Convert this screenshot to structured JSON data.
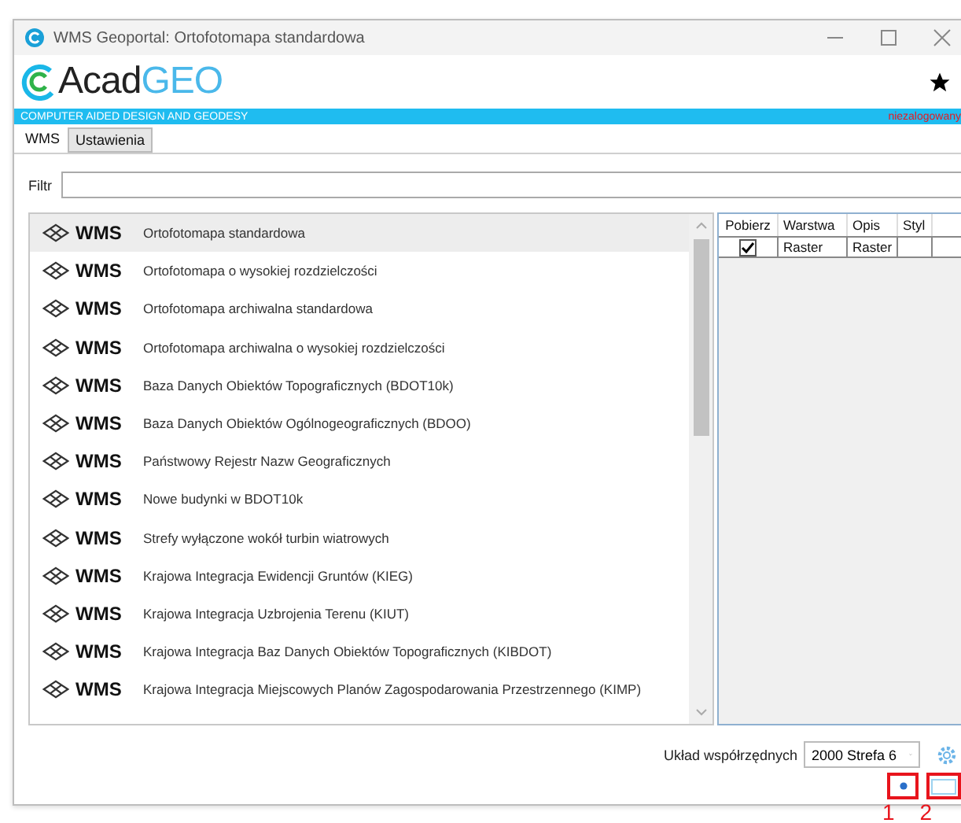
{
  "window": {
    "title": "WMS Geoportal: Ortofotomapa standardowa"
  },
  "logo": {
    "part_1": "Acad",
    "part_2": "GEO"
  },
  "banner": {
    "tagline": "COMPUTER AIDED DESIGN AND GEODESY",
    "status": "niezalogowany"
  },
  "tabs": [
    {
      "label": "WMS",
      "selected": true
    },
    {
      "label": "Ustawienia",
      "selected": false
    }
  ],
  "filter": {
    "label": "Filtr"
  },
  "services": [
    {
      "badge": "WMS",
      "name": "Ortofotomapa standardowa",
      "selected": true
    },
    {
      "badge": "WMS",
      "name": "Ortofotomapa o wysokiej rozdzielczości",
      "selected": false
    },
    {
      "badge": "WMS",
      "name": "Ortofotomapa archiwalna standardowa",
      "selected": false
    },
    {
      "badge": "WMS",
      "name": "Ortofotomapa archiwalna o wysokiej rozdzielczości",
      "selected": false
    },
    {
      "badge": "WMS",
      "name": "Baza Danych Obiektów Topograficznych (BDOT10k)",
      "selected": false
    },
    {
      "badge": "WMS",
      "name": "Baza Danych Obiektów Ogólnogeograficznych (BDOO)",
      "selected": false
    },
    {
      "badge": "WMS",
      "name": "Państwowy Rejestr Nazw Geograficznych",
      "selected": false
    },
    {
      "badge": "WMS",
      "name": "Nowe budynki w BDOT10k",
      "selected": false
    },
    {
      "badge": "WMS",
      "name": "Strefy wyłączone wokół turbin wiatrowych",
      "selected": false
    },
    {
      "badge": "WMS",
      "name": "Krajowa Integracja Ewidencji Gruntów (KIEG)",
      "selected": false
    },
    {
      "badge": "WMS",
      "name": "Krajowa Integracja Uzbrojenia Terenu (KIUT)",
      "selected": false
    },
    {
      "badge": "WMS",
      "name": "Krajowa Integracja Baz Danych Obiektów Topograficznych (KIBDOT)",
      "selected": false
    },
    {
      "badge": "WMS",
      "name": "Krajowa Integracja Miejscowych Planów Zagospodarowania Przestrzennego (KIMP)",
      "selected": false
    }
  ],
  "layers": {
    "columns": [
      "Pobierz",
      "Warstwa",
      "Opis",
      "Styl"
    ],
    "rows": [
      {
        "checked": true,
        "layer": "Raster",
        "description": "Raster"
      }
    ]
  },
  "coordinate_system": {
    "label": "Układ współrzędnych",
    "value": "2000 Strefa 6"
  },
  "annotations": [
    "1",
    "2"
  ]
}
